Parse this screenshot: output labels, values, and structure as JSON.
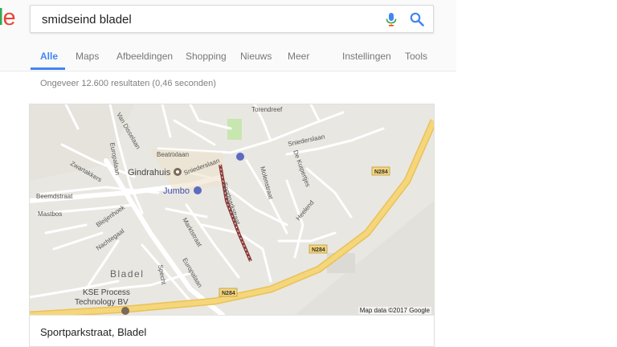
{
  "logo": {
    "part1": "l",
    "part2": "e"
  },
  "search": {
    "query": "smidseind bladel"
  },
  "tabs": [
    {
      "label": "Alle",
      "active": true
    },
    {
      "label": "Maps"
    },
    {
      "label": "Afbeeldingen"
    },
    {
      "label": "Shopping"
    },
    {
      "label": "Nieuws"
    },
    {
      "label": "Meer"
    },
    {
      "label": "Instellingen"
    },
    {
      "label": "Tools"
    }
  ],
  "stats": "Ongeveer 12.600 resultaten (0,46 seconden)",
  "map": {
    "attribution": "Map data ©2017 Google",
    "labels": {
      "torendreef": "Torendreef",
      "van_disselaan": "Van Disselaan",
      "beatrixlaan": "Beatrixlaan",
      "sniederslaan_e": "Sniederslaan",
      "europalaan_n": "Europalaan",
      "zwartakkers": "Zwartakkers",
      "gindrahuis": "Gindrahuis",
      "sniederslaan_w": "Sniederslaan",
      "de_kuipertjes": "De Kuipertjes",
      "n284_top": "N284",
      "beemdstraat": "Beemdstraat",
      "jumbo": "Jumbo",
      "sportparkstraat": "Sportparkstraat",
      "molenstraat": "Molenstraat",
      "heelend": "Heelend",
      "mastbos": "Mastbos",
      "bleijenhoek": "Bleijenhoek",
      "marktstraat": "Marktstraat",
      "nachtegaal": "Nachtegaal",
      "n284_mid": "N284",
      "bladel": "Bladel",
      "europalaan_s": "Europalaan",
      "specht": "Specht",
      "kse1": "KSE Process",
      "kse2": "Technology BV",
      "n284_bottom": "N284"
    }
  },
  "result": {
    "title": "Sportparkstraat, Bladel"
  },
  "colors": {
    "accent": "#4285f4",
    "route": "#8b3a3a",
    "highway": "#f6d67a",
    "map_bg": "#e9e7e2",
    "park": "#c8e6b0"
  }
}
